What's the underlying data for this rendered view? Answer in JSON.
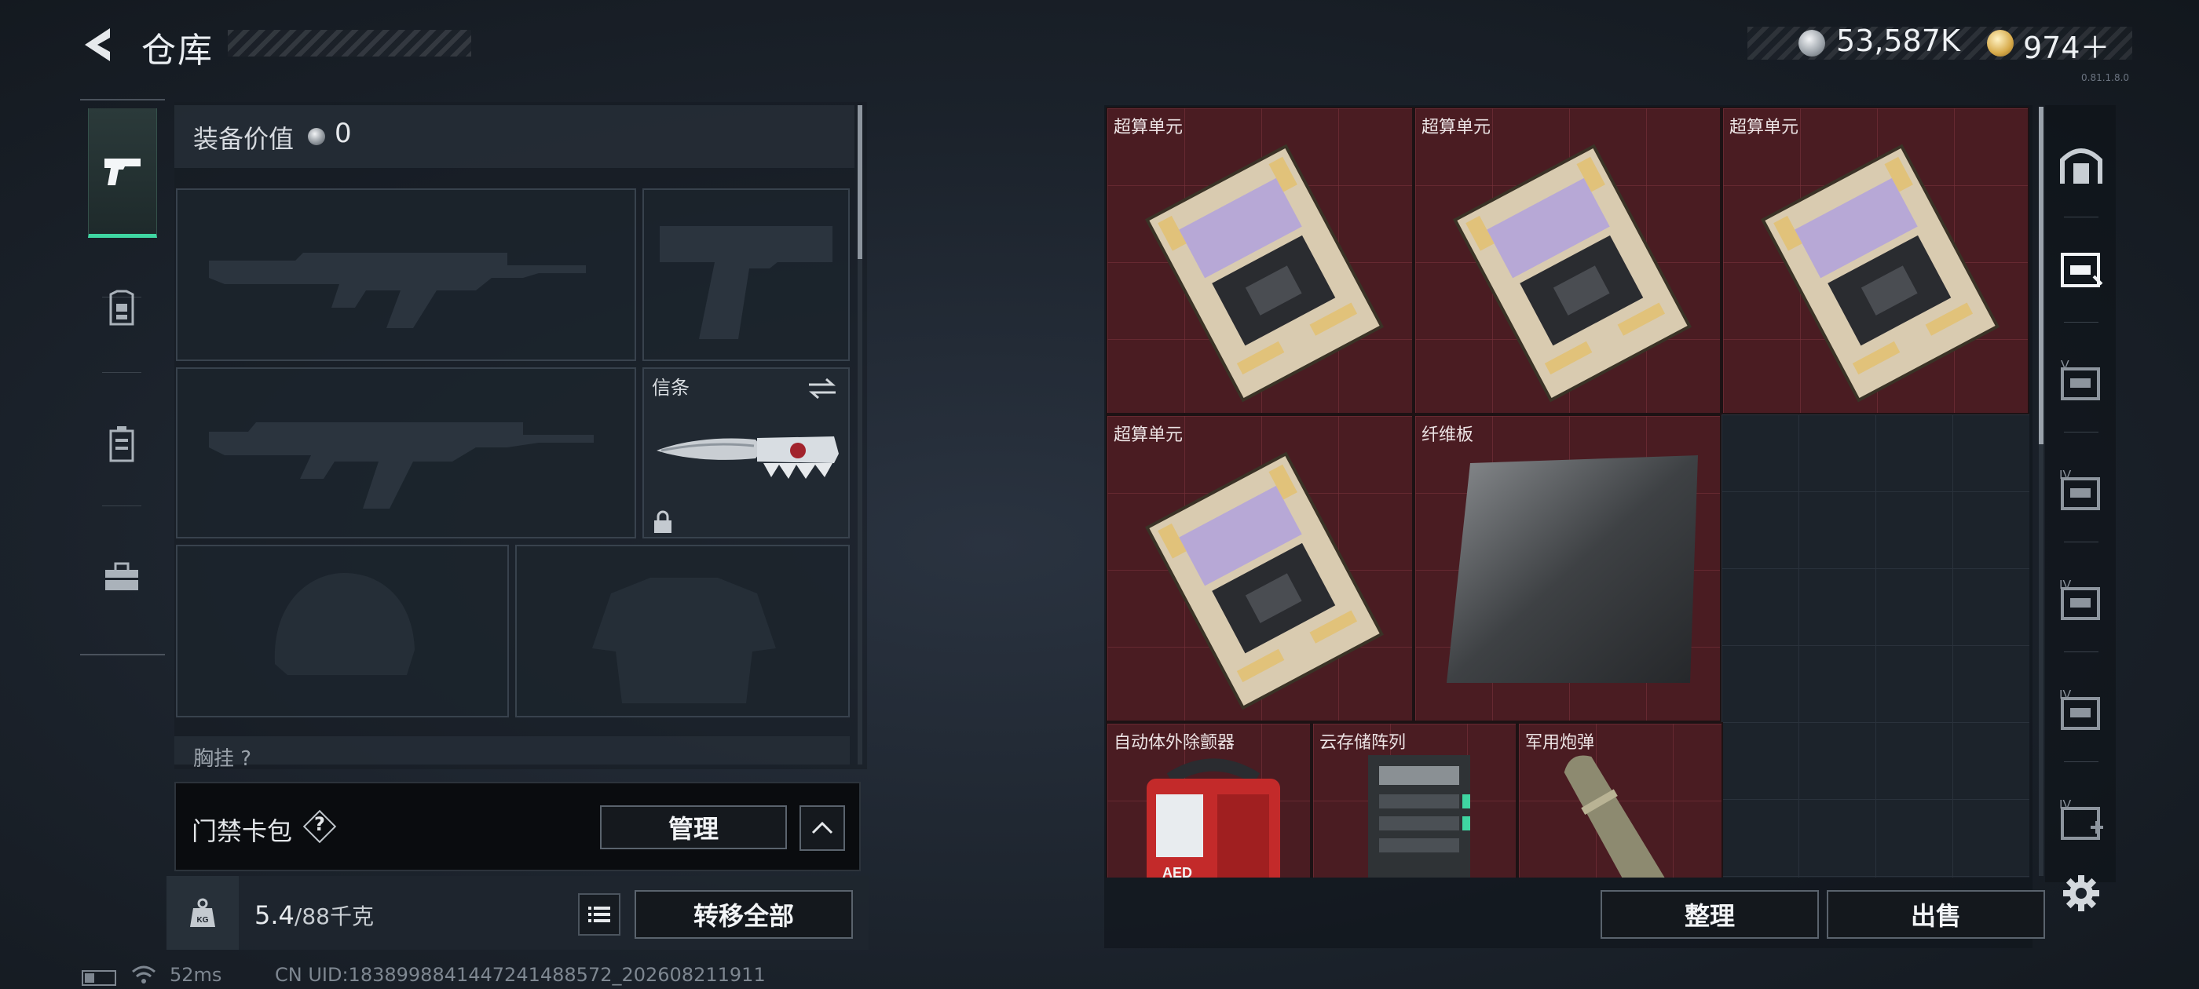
{
  "header": {
    "title": "仓库",
    "currency_silver": "53,587K",
    "currency_gold": "974＋",
    "version_tag": "0.81.1.8.0"
  },
  "nav": {
    "items": [
      {
        "name": "firearm",
        "icon": "pistol-icon",
        "active": true
      },
      {
        "name": "armor",
        "icon": "armor-icon",
        "active": false
      },
      {
        "name": "backpack",
        "icon": "backpack-icon",
        "active": false
      },
      {
        "name": "toolbox",
        "icon": "briefcase-icon",
        "active": false
      }
    ]
  },
  "equipment": {
    "value_label": "装备价值",
    "value": "0",
    "melee_slot_label": "信条",
    "partial_label": "胸挂 ?"
  },
  "keycard": {
    "label": "门禁卡包",
    "help": "?",
    "manage_label": "管理"
  },
  "weight": {
    "current": "5.4",
    "capacity": "/88千克",
    "transfer_all_label": "转移全部"
  },
  "status": {
    "ping": "52ms",
    "uid": "CN UID:1838998841447241488572_202608211911"
  },
  "storage": {
    "items": [
      {
        "name": "超算单元",
        "type": "compute-unit"
      },
      {
        "name": "超算单元",
        "type": "compute-unit"
      },
      {
        "name": "超算单元",
        "type": "compute-unit"
      },
      {
        "name": "超算单元",
        "type": "compute-unit"
      },
      {
        "name": "纤维板",
        "type": "fiberboard"
      },
      {
        "name": "自动体外除颤器",
        "type": "defibrillator"
      },
      {
        "name": "云存储阵列",
        "type": "storage-array"
      },
      {
        "name": "军用炮弹",
        "type": "shell"
      }
    ],
    "sort_label": "整理",
    "sell_label": "出售"
  },
  "storage_tabs": [
    {
      "icon": "home-safe-icon"
    },
    {
      "icon": "storage-tab-icon",
      "tier": ""
    },
    {
      "icon": "storage-tab-icon",
      "tier": "V"
    },
    {
      "icon": "storage-tab-icon",
      "tier": "IV"
    },
    {
      "icon": "storage-tab-icon",
      "tier": "IV"
    },
    {
      "icon": "storage-tab-icon",
      "tier": "IV"
    },
    {
      "icon": "storage-tab-add-icon",
      "tier": "IV"
    }
  ],
  "colors": {
    "accent": "#3fd6a2",
    "item_bg": "#4a1c22",
    "panel": "#1c232b"
  }
}
